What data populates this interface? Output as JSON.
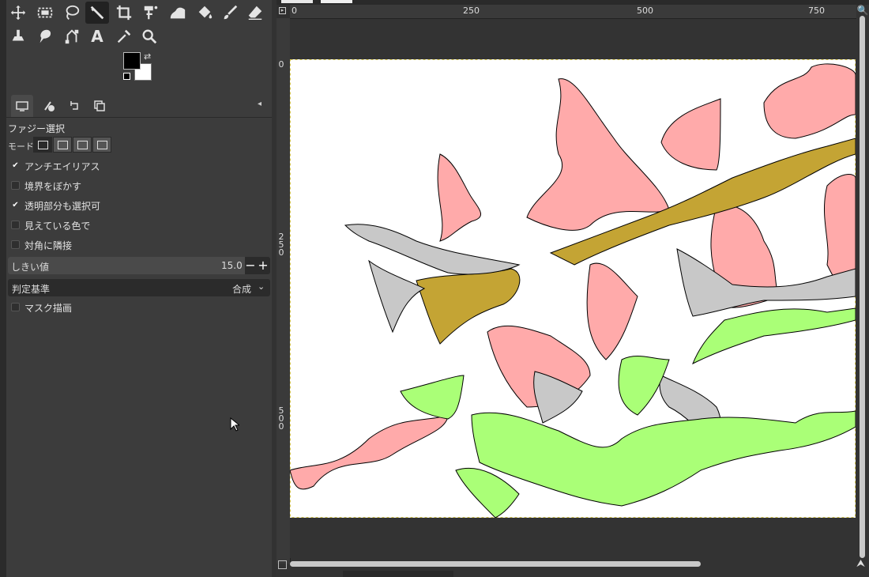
{
  "tools": {
    "row1": [
      "move-tool",
      "rect-select-tool",
      "free-select-tool",
      "fuzzy-select-tool",
      "crop-tool",
      "transform-tool",
      "warp-tool",
      "bucket-fill-tool",
      "paintbrush-tool",
      "eraser-tool"
    ],
    "row2": [
      "clone-tool",
      "smudge-tool",
      "paths-tool",
      "text-tool",
      "color-picker-tool",
      "zoom-tool"
    ],
    "text_tool_glyph": "A",
    "active": "fuzzy-select-tool"
  },
  "colors": {
    "foreground": "#000000",
    "background": "#ffffff"
  },
  "tool_options": {
    "title": "ファジー選択",
    "mode_label": "モード:",
    "checkboxes": [
      {
        "label": "アンチエイリアス",
        "checked": true
      },
      {
        "label": "境界をぼかす",
        "checked": false
      },
      {
        "label": "透明部分も選択可",
        "checked": true
      },
      {
        "label": "見えている色で",
        "checked": false
      },
      {
        "label": "対角に隣接",
        "checked": false
      }
    ],
    "threshold_label": "しきい値",
    "threshold_value": "15.0",
    "criterion_label": "判定基準",
    "criterion_value": "合成",
    "draw_mask": {
      "label": "マスク描画",
      "checked": false
    }
  },
  "ruler": {
    "h_ticks": [
      "0",
      "250",
      "500",
      "750"
    ],
    "v_ticks": [
      "0",
      "250",
      "500"
    ]
  },
  "image_colors": {
    "pink": "#ffaaaa",
    "olive": "#c4a434",
    "gray": "#c8c8c8",
    "green": "#aaff77"
  }
}
